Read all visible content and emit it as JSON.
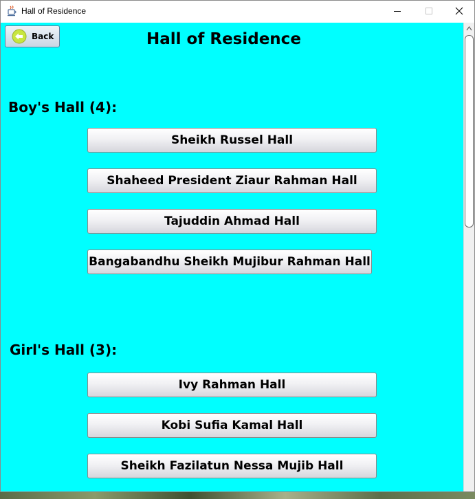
{
  "window": {
    "title": "Hall of Residence"
  },
  "toolbar": {
    "back_label": "Back"
  },
  "page": {
    "title": "Hall of Residence"
  },
  "boys": {
    "heading": "Boy's Hall (4):",
    "halls": [
      "Sheikh Russel Hall",
      "Shaheed President Ziaur Rahman Hall",
      "Tajuddin Ahmad Hall",
      "Bangabandhu Sheikh Mujibur Rahman Hall"
    ]
  },
  "girls": {
    "heading": "Girl's Hall (3):",
    "halls": [
      "Ivy Rahman Hall",
      "Kobi Sufia Kamal Hall",
      "Sheikh Fazilatun Nessa Mujib Hall"
    ]
  },
  "icons": {
    "app": "java-app-icon",
    "back": "back-arrow-icon",
    "minimize": "minimize-icon",
    "maximize": "maximize-icon",
    "close": "close-icon",
    "scroll_up": "scroll-up-arrow-icon"
  },
  "colors": {
    "content_background": "#00ffff",
    "back_icon_fill": "#c8e640"
  }
}
